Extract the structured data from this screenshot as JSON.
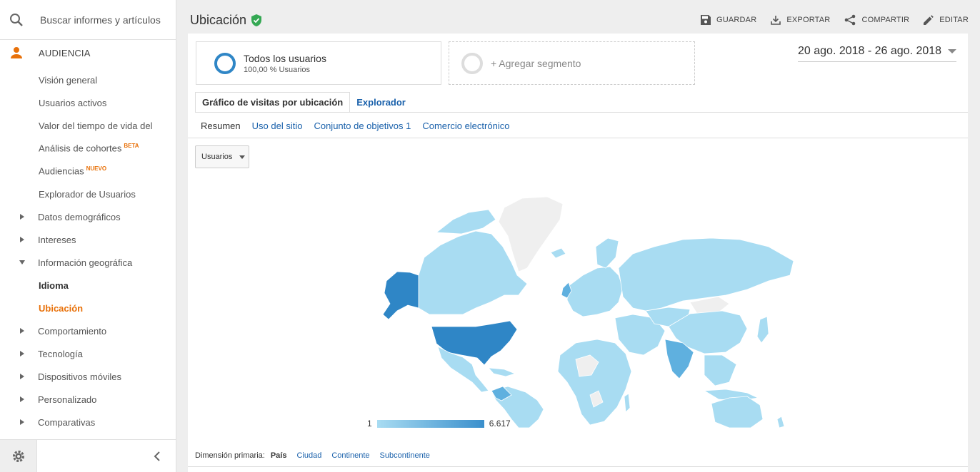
{
  "search": {
    "placeholder": "Buscar informes y artículos",
    "icon": "search-icon"
  },
  "section": {
    "label": "AUDIENCIA",
    "icon": "person-icon",
    "icon_color": "#e8710a"
  },
  "nav": {
    "items": [
      {
        "label": "Visión general"
      },
      {
        "label": "Usuarios activos"
      },
      {
        "label": "Valor del tiempo de vida del"
      },
      {
        "label": "Análisis de cohortes",
        "badge": "BETA"
      },
      {
        "label": "Audiencias",
        "badge": "NUEVO"
      },
      {
        "label": "Explorador de Usuarios"
      },
      {
        "label": "Datos demográficos"
      },
      {
        "label": "Intereses"
      },
      {
        "label": "Información geográfica"
      },
      {
        "label": "Idioma"
      },
      {
        "label": "Ubicación"
      },
      {
        "label": "Comportamiento"
      },
      {
        "label": "Tecnología"
      },
      {
        "label": "Dispositivos móviles"
      },
      {
        "label": "Personalizado"
      },
      {
        "label": "Comparativas"
      }
    ]
  },
  "header": {
    "title": "Ubicación",
    "verified_icon": "shield-check-icon",
    "actions": {
      "save": "GUARDAR",
      "export": "EXPORTAR",
      "share": "COMPARTIR",
      "edit": "EDITAR"
    }
  },
  "segments": {
    "active_title": "Todos los usuarios",
    "active_sub": "100,00 % Usuarios",
    "add_label": "+ Agregar segmento"
  },
  "date_range": "20 ago. 2018 - 26 ago. 2018",
  "tabs": {
    "map_overlay": "Gráfico de visitas por ubicación",
    "explorer": "Explorador"
  },
  "subtabs": {
    "summary": "Resumen",
    "site_usage": "Uso del sitio",
    "goal_set": "Conjunto de objetivos 1",
    "ecommerce": "Comercio electrónico"
  },
  "metric_select": "Usuarios",
  "legend": {
    "min": "1",
    "max": "6.617",
    "color_low": "#a8dcf2",
    "color_high": "#3a8fcc"
  },
  "primary_dimension": {
    "label": "Dimensión primaria:",
    "current": "País",
    "options": {
      "city": "Ciudad",
      "continent": "Continente",
      "subcontinent": "Subcontinente"
    }
  },
  "colors": {
    "accent": "#e8710a",
    "link": "#1a61ab",
    "map_high": "#2f86c6",
    "map_mid": "#5fb0df",
    "map_low": "#a8dcf2",
    "map_none": "#efefef"
  }
}
